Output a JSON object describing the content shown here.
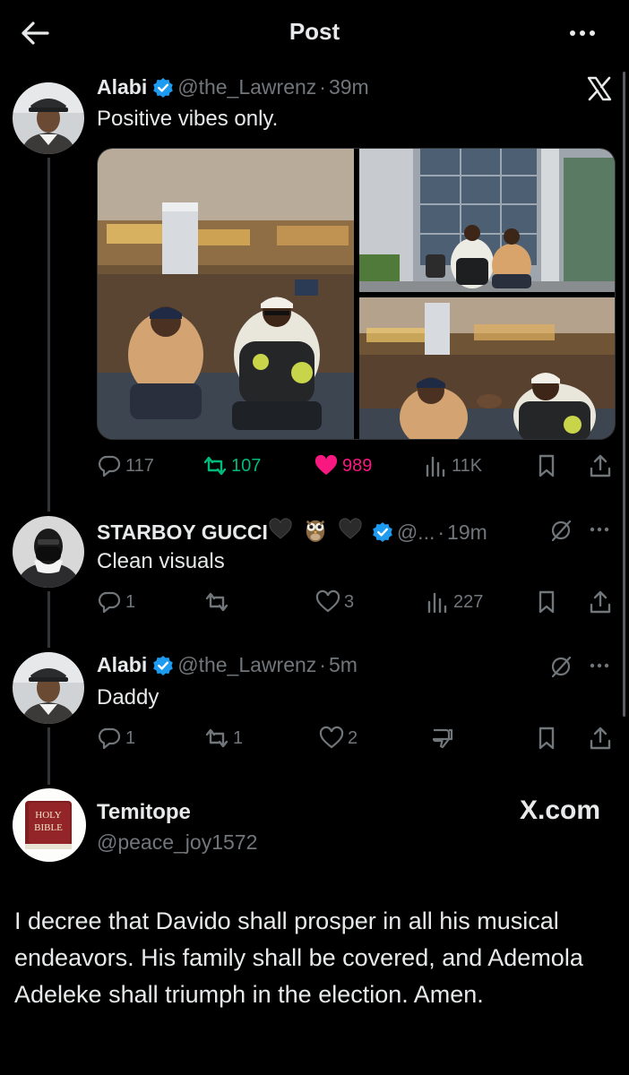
{
  "header": {
    "title": "Post",
    "back_icon": "arrow-left-icon",
    "more_icon": "more-horizontal-icon"
  },
  "brand_icon": "x-logo-icon",
  "main_post": {
    "author": "Alabi",
    "handle": "@the_Lawrenz",
    "dot": "·",
    "time": "39m",
    "text": "Positive vibes only.",
    "media_count": 3,
    "stats": {
      "replies": "117",
      "reposts": "107",
      "likes": "989",
      "views": "11K"
    },
    "colors": {
      "repost_active": "#00ba7c",
      "like_active": "#f91880"
    }
  },
  "replies": [
    {
      "author": "STARBOY GUCCI",
      "handle": "@...",
      "dot": "·",
      "time": "19m",
      "text": "Clean visuals",
      "stats": {
        "replies": "1",
        "reposts": "",
        "likes": "3",
        "views": "227"
      }
    },
    {
      "author": "Alabi",
      "handle": "@the_Lawrenz",
      "dot": "·",
      "time": "5m",
      "text": "Daddy",
      "stats": {
        "replies": "1",
        "reposts": "1",
        "likes": "2"
      }
    }
  ],
  "quote_card": {
    "author": "Temitope",
    "handle": "@peace_joy1572",
    "site": "X.com",
    "avatar_text_line1": "HOLY",
    "avatar_text_line2": "BIBLE",
    "text": "I decree that Davido shall prosper in all his musical endeavors. His family shall be covered, and Ademola Adeleke shall triumph in the election. Amen."
  },
  "colors": {
    "background": "#000000",
    "text": "#e7e9ea",
    "muted": "#71767b",
    "verified": "#1d9bf0"
  }
}
